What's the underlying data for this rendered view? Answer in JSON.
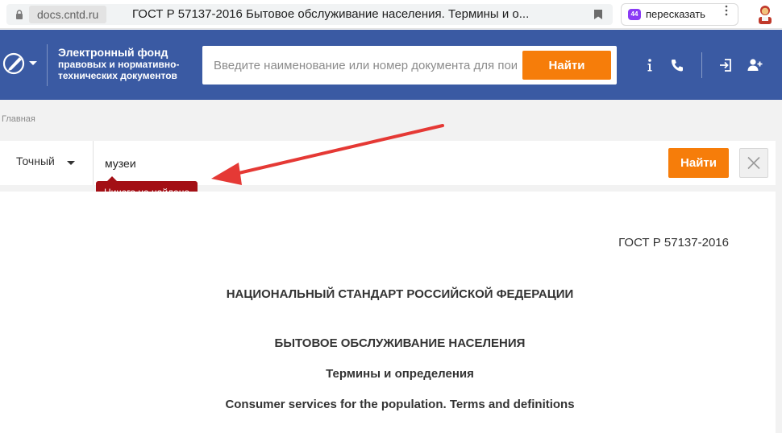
{
  "browser": {
    "domain": "docs.cntd.ru",
    "tab_title": "ГОСТ Р 57137-2016 Бытовое обслуживание населения. Термины и о...",
    "retell_label": "пересказать",
    "retell_badge": "44"
  },
  "header": {
    "brand_title": "Электронный фонд",
    "brand_sub1": "правовых и нормативно-",
    "brand_sub2": "технических документов",
    "search_placeholder": "Введите наименование или номер документа для поиска",
    "find_label": "Найти",
    "icons": [
      "info-icon",
      "phone-icon",
      "login-icon",
      "add-user-icon"
    ]
  },
  "breadcrumb": {
    "home": "Главная"
  },
  "search": {
    "mode": "Точный",
    "query": "музеи",
    "find_label": "Найти",
    "not_found": "Ничего не найдено"
  },
  "document": {
    "number": "ГОСТ Р 57137-2016",
    "heading": "НАЦИОНАЛЬНЫЙ СТАНДАРТ РОССИЙСКОЙ ФЕДЕРАЦИИ",
    "title": "БЫТОВОЕ ОБСЛУЖИВАНИЕ НАСЕЛЕНИЯ",
    "subtitle": "Термины и определения",
    "english_title": "Consumer services for the population. Terms and definitions"
  },
  "colors": {
    "header_bg": "#3a5aa3",
    "accent_orange": "#f67d0a",
    "tooltip_red": "#a30f15",
    "arrow_red": "#e53935"
  }
}
